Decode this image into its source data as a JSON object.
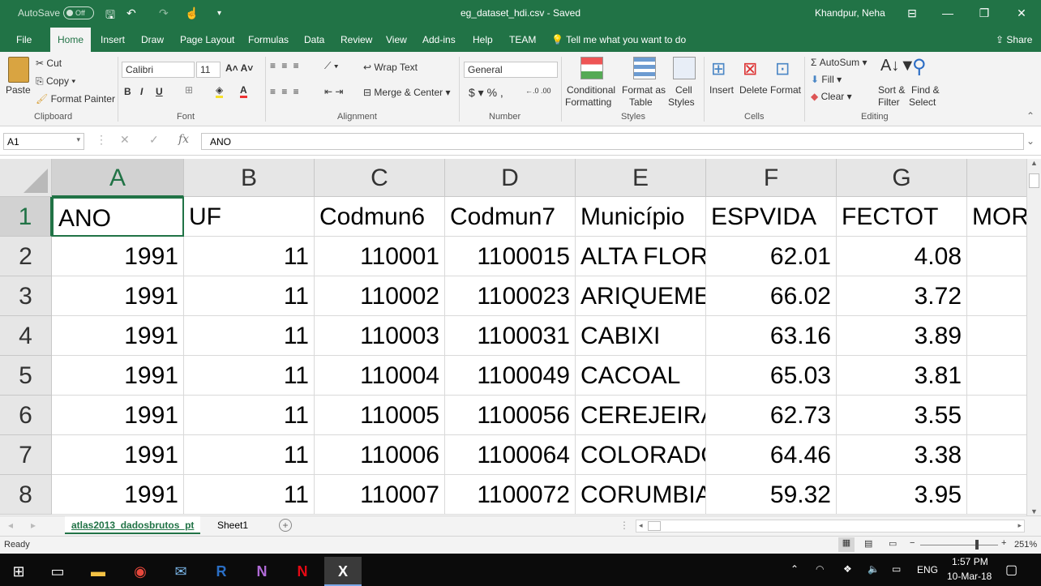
{
  "title_bar": {
    "autosave_label": "AutoSave",
    "autosave_state": "Off",
    "document_title": "eg_dataset_hdi.csv  -  Saved",
    "user_name": "Khandpur, Neha"
  },
  "ribbon_tabs": [
    "File",
    "Home",
    "Insert",
    "Draw",
    "Page Layout",
    "Formulas",
    "Data",
    "Review",
    "View",
    "Add-ins",
    "Help",
    "TEAM"
  ],
  "active_tab": "Home",
  "tell_me": "Tell me what you want to do",
  "share_label": "Share",
  "ribbon": {
    "clipboard": {
      "paste": "Paste",
      "cut": "Cut",
      "copy": "Copy",
      "format_painter": "Format Painter",
      "group": "Clipboard"
    },
    "font": {
      "name": "Calibri",
      "size": "11",
      "group": "Font"
    },
    "alignment": {
      "wrap_text": "Wrap Text",
      "merge_center": "Merge & Center",
      "group": "Alignment"
    },
    "number": {
      "format": "General",
      "group": "Number"
    },
    "styles": {
      "conditional": [
        "Conditional",
        "Formatting"
      ],
      "format_table": [
        "Format as",
        "Table"
      ],
      "cell_styles": [
        "Cell",
        "Styles"
      ],
      "group": "Styles"
    },
    "cells": {
      "insert": "Insert",
      "delete": "Delete",
      "format": "Format",
      "group": "Cells"
    },
    "editing": {
      "autosum": "AutoSum",
      "fill": "Fill",
      "clear": "Clear",
      "sort_filter": [
        "Sort &",
        "Filter"
      ],
      "find_select": [
        "Find &",
        "Select"
      ],
      "group": "Editing"
    }
  },
  "formula_bar": {
    "name_box": "A1",
    "fx": "fx",
    "formula": "ANO"
  },
  "grid": {
    "columns": [
      "A",
      "B",
      "C",
      "D",
      "E",
      "F",
      "G"
    ],
    "rows": [
      "1",
      "2",
      "3",
      "4",
      "5",
      "6",
      "7",
      "8"
    ],
    "header_row": [
      "ANO",
      "UF",
      "Codmun6",
      "Codmun7",
      "Município",
      "ESPVIDA",
      "FECTOT",
      "MOR"
    ],
    "data_rows": [
      [
        "1991",
        "11",
        "110001",
        "1100015",
        "ALTA FLOR",
        "62.01",
        "4.08"
      ],
      [
        "1991",
        "11",
        "110002",
        "1100023",
        "ARIQUEME",
        "66.02",
        "3.72"
      ],
      [
        "1991",
        "11",
        "110003",
        "1100031",
        "CABIXI",
        "63.16",
        "3.89"
      ],
      [
        "1991",
        "11",
        "110004",
        "1100049",
        "CACOAL",
        "65.03",
        "3.81"
      ],
      [
        "1991",
        "11",
        "110005",
        "1100056",
        "CEREJEIRA",
        "62.73",
        "3.55"
      ],
      [
        "1991",
        "11",
        "110006",
        "1100064",
        "COLORADO",
        "64.46",
        "3.38"
      ],
      [
        "1991",
        "11",
        "110007",
        "1100072",
        "CORUMBIA",
        "59.32",
        "3.95"
      ]
    ]
  },
  "sheets": [
    "atlas2013_dadosbrutos_pt",
    "Sheet1"
  ],
  "active_sheet": "atlas2013_dadosbrutos_pt",
  "status": {
    "ready": "Ready",
    "zoom": "251%"
  },
  "taskbar": {
    "time": "1:57 PM",
    "date": "10-Mar-18",
    "language": "ENG"
  },
  "colors": {
    "excel_green": "#217346",
    "ribbon_bg": "#f3f3f3",
    "taskbar_bg": "#0b0b0b"
  }
}
